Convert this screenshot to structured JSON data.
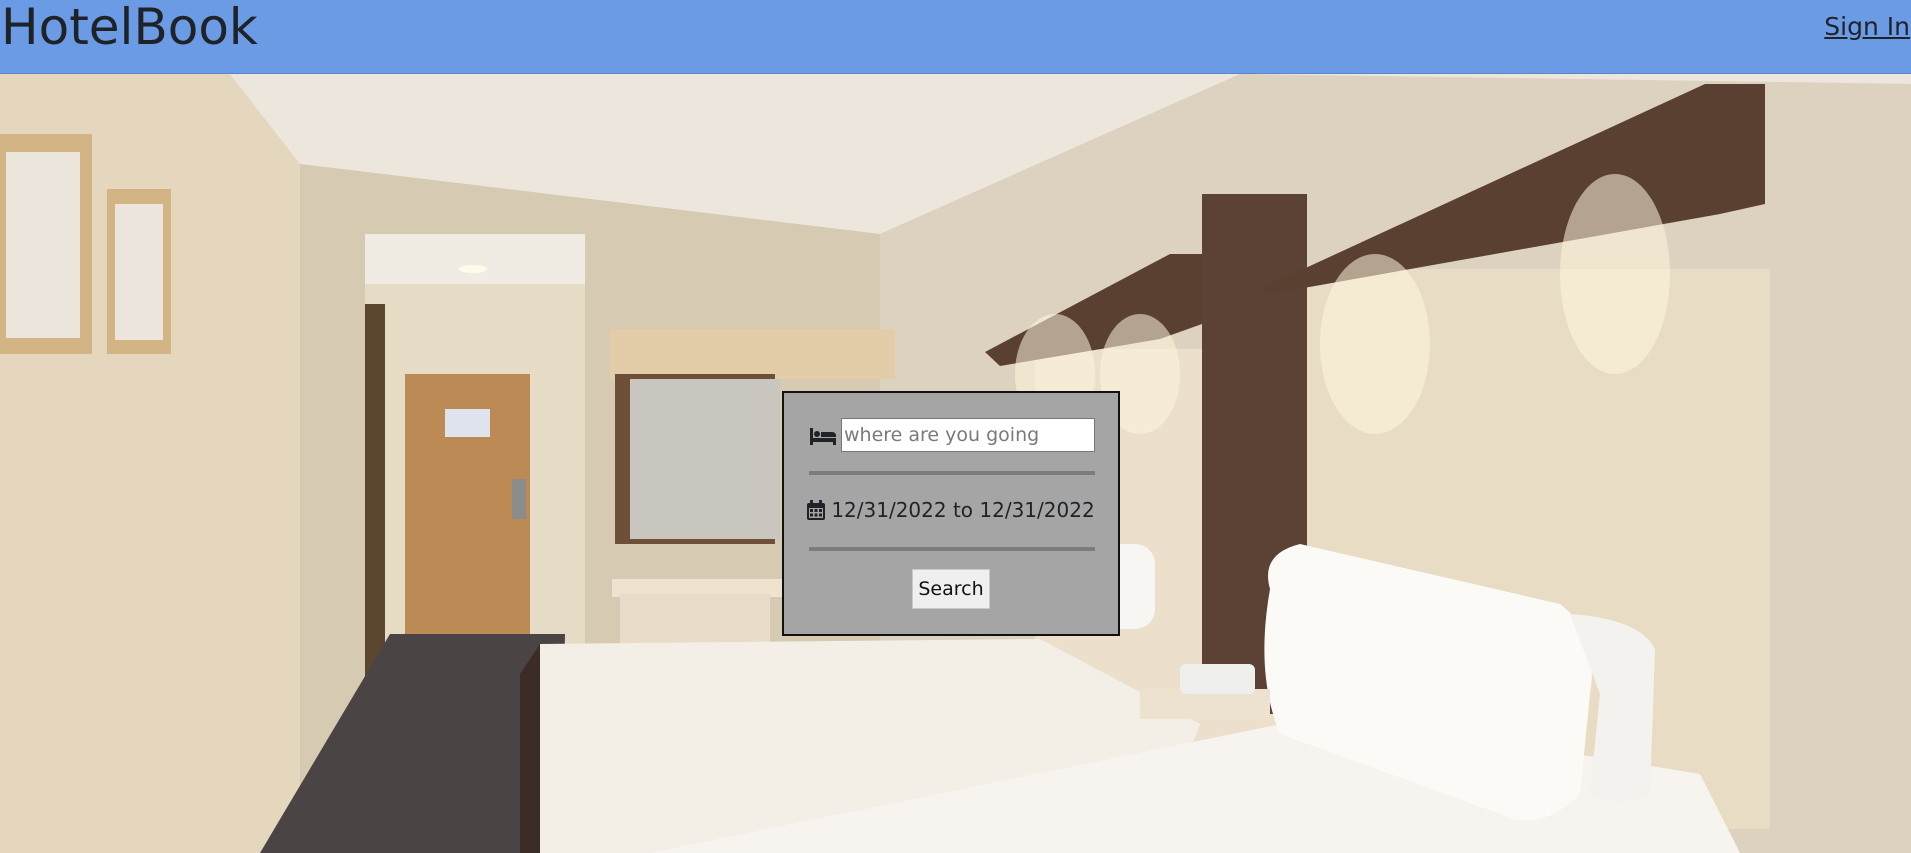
{
  "header": {
    "brand": "HotelBook",
    "signin_label": "Sign In",
    "background_color": "#6c9be6"
  },
  "hero": {
    "image_description_icon": "hotel-room-photo"
  },
  "search": {
    "destination_placeholder": "where are you going",
    "destination_value": "",
    "destination_icon": "bed-icon",
    "date_icon": "calendar-icon",
    "date_range": "12/31/2022 to 12/31/2022",
    "submit_label": "Search"
  }
}
